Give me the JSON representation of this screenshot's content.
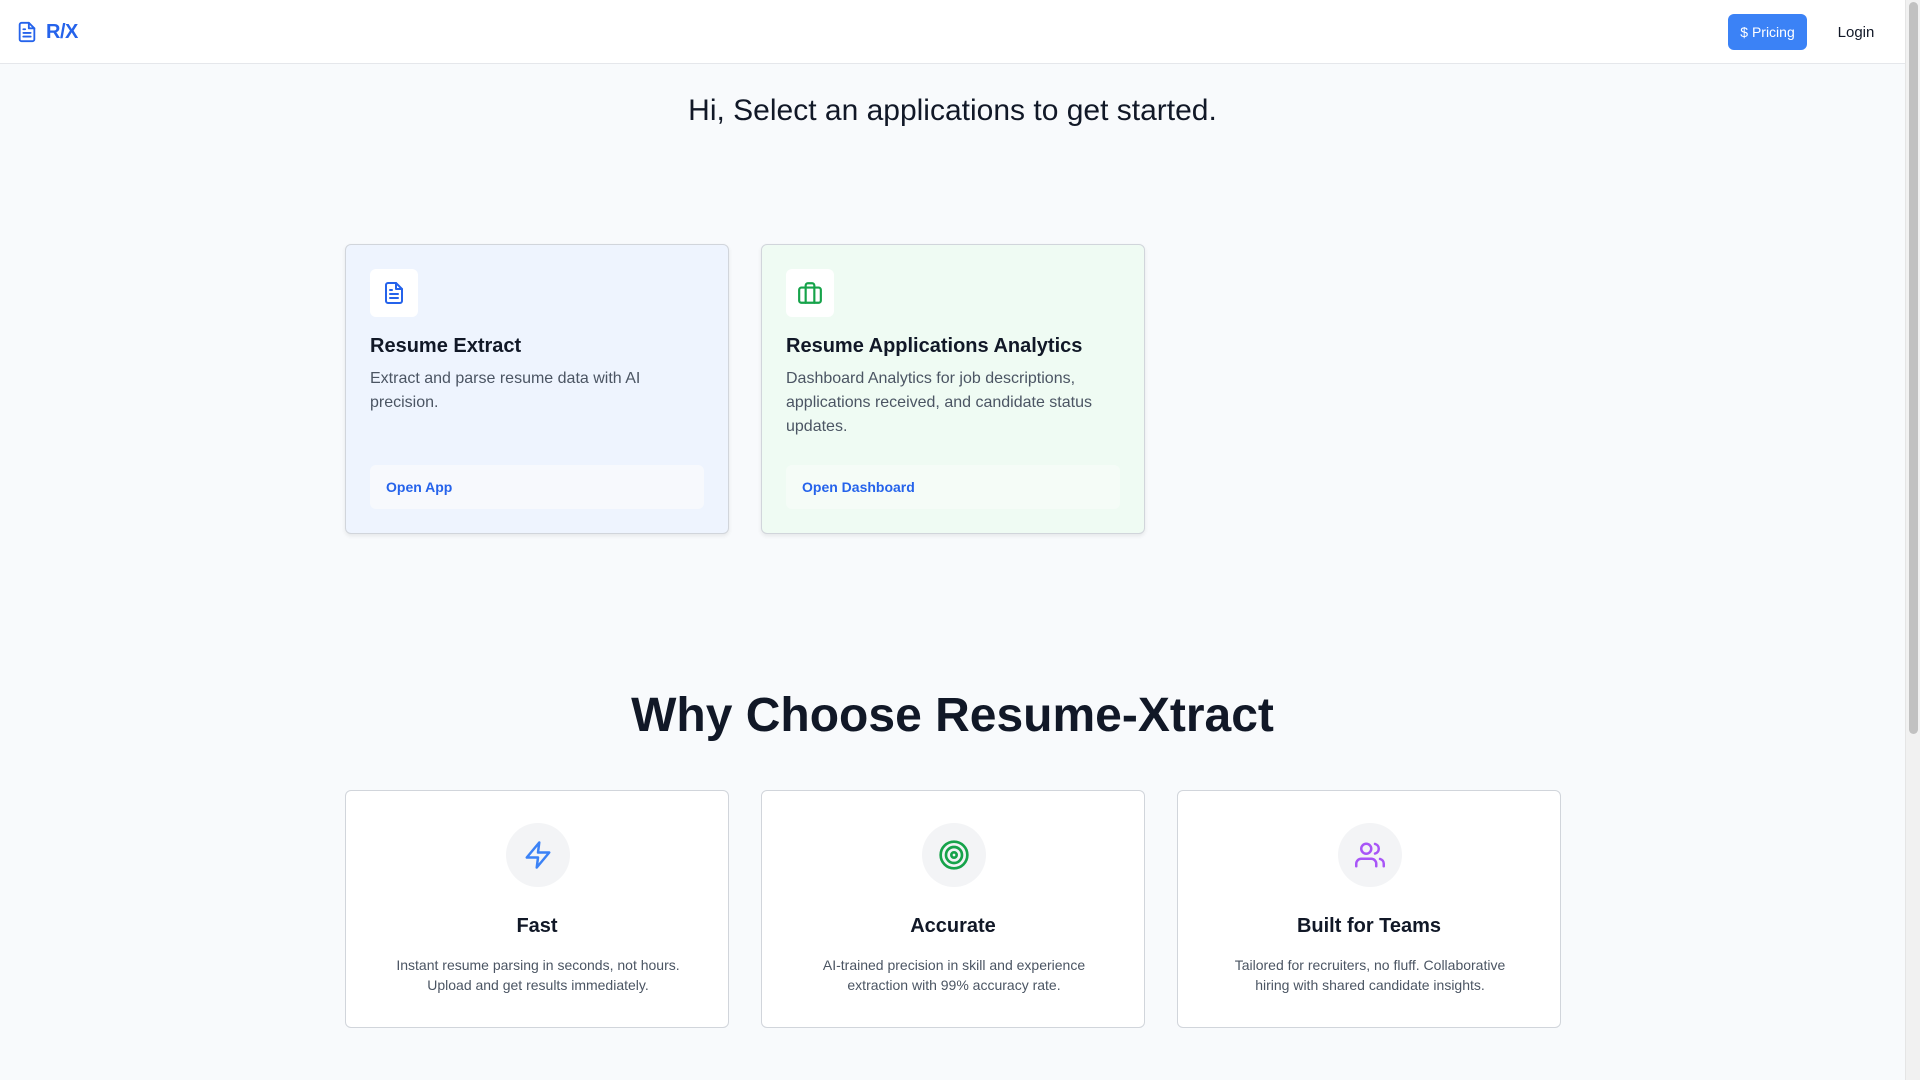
{
  "header": {
    "logo_text": "R/X",
    "pricing_label": "$ Pricing",
    "login_label": "Login"
  },
  "greeting": "Hi, Select an applications to get started.",
  "apps": [
    {
      "title": "Resume Extract",
      "description": "Extract and parse resume data with AI precision.",
      "button_label": "Open App",
      "icon": "file-text-icon",
      "accent": "#2563eb"
    },
    {
      "title": "Resume Applications Analytics",
      "description": "Dashboard Analytics for job descriptions, applications received, and candidate status updates.",
      "button_label": "Open Dashboard",
      "icon": "briefcase-icon",
      "accent": "#16a34a"
    }
  ],
  "why": {
    "title": "Why Choose Resume-Xtract",
    "features": [
      {
        "title": "Fast",
        "description": "Instant resume parsing in seconds, not hours. Upload and get results immediately.",
        "icon": "zap-icon",
        "color": "#3b82f6"
      },
      {
        "title": "Accurate",
        "description": "AI-trained precision in skill and experience extraction with 99% accuracy rate.",
        "icon": "target-icon",
        "color": "#16a34a"
      },
      {
        "title": "Built for Teams",
        "description": "Tailored for recruiters, no fluff. Collaborative hiring with shared candidate insights.",
        "icon": "users-icon",
        "color": "#a855f7"
      }
    ]
  },
  "colors": {
    "brand": "#2563eb",
    "pricing_button": "#3b82f6"
  }
}
